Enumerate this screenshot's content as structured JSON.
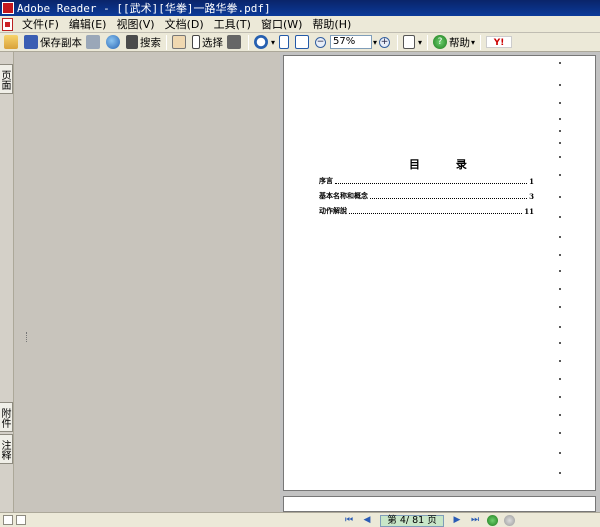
{
  "window": {
    "title": "Adobe Reader - [[武术][华拳]一路华拳.pdf]"
  },
  "menu": [
    "文件(F)",
    "编辑(E)",
    "视图(V)",
    "文档(D)",
    "工具(T)",
    "窗口(W)",
    "帮助(H)"
  ],
  "toolbar": {
    "save_copy": "保存副本",
    "search": "搜索",
    "select": "选择",
    "zoom_value": "57%",
    "help": "帮助",
    "yahoo_logo": "Y!"
  },
  "left_tabs": {
    "pages": "页面",
    "attachments": "附件",
    "comments": "注释"
  },
  "page": {
    "toc_title": "目 录",
    "toc": [
      {
        "label": "序言",
        "page": "1"
      },
      {
        "label": "基本名称和概念",
        "page": "3"
      },
      {
        "label": "动作解說",
        "page": "11"
      }
    ]
  },
  "statusbar": {
    "page_indicator": "第 4/ 81 页"
  }
}
